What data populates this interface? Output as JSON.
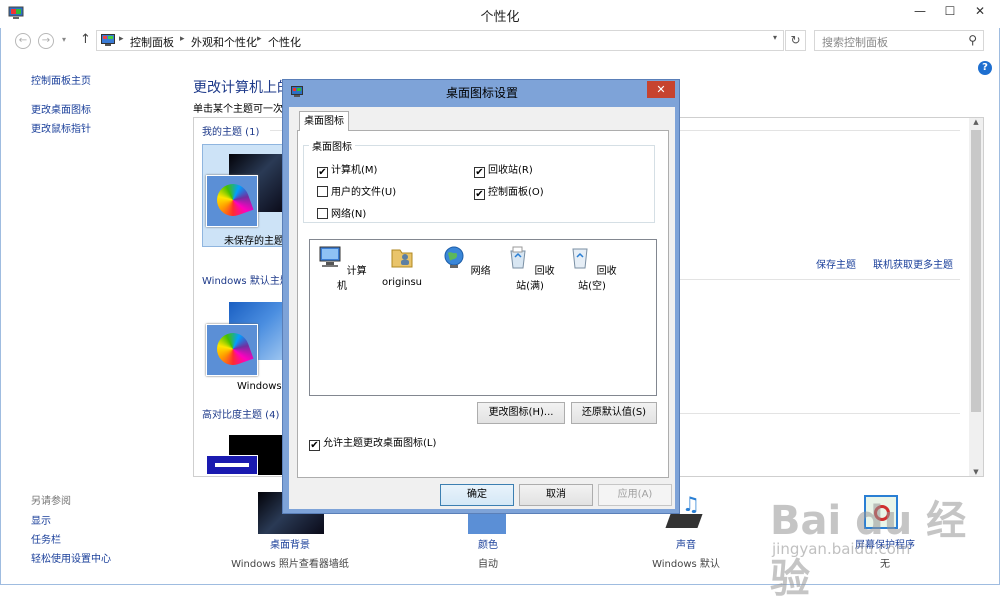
{
  "window": {
    "title": "个性化",
    "min_glyph": "—",
    "max_glyph": "☐",
    "close_glyph": "✕"
  },
  "nav": {
    "back_glyph": "←",
    "forward_glyph": "→",
    "dropdown_glyph": "▾",
    "up_glyph": "↑",
    "breadcrumb": [
      "控制面板",
      "外观和个性化",
      "个性化"
    ],
    "breadcrumb_sep": "▸",
    "refresh_glyph": "↻",
    "search_placeholder": "搜索控制面板",
    "search_glyph": "⚲",
    "help_glyph": "?"
  },
  "sidebar": {
    "home": "控制面板主页",
    "items": [
      "更改桌面图标",
      "更改鼠标指针"
    ],
    "see_also_title": "另请参阅",
    "see_also": [
      "显示",
      "任务栏",
      "轻松使用设置中心"
    ]
  },
  "main": {
    "title": "更改计算机上的视觉效果和声音",
    "subtitle": "单击某个主题可一次",
    "groups": {
      "my_themes": "我的主题 (1)",
      "windows_default": "Windows 默认主题",
      "high_contrast": "高对比度主题 (4)"
    },
    "themes": {
      "unsaved": "未保存的主题",
      "windows": "Windows"
    },
    "links": {
      "save_theme": "保存主题",
      "get_more": "联机获取更多主题"
    }
  },
  "bottom": [
    {
      "label": "桌面背景",
      "value": "Windows 照片查看器墙纸"
    },
    {
      "label": "颜色",
      "value": "自动"
    },
    {
      "label": "声音",
      "value": "Windows 默认"
    },
    {
      "label": "屏幕保护程序",
      "value": "无"
    }
  ],
  "watermark": {
    "text": "Bai du 经验",
    "sub": "jingyan.baidu.com"
  },
  "dialog": {
    "title": "桌面图标设置",
    "close_glyph": "✕",
    "tab": "桌面图标",
    "group_title": "桌面图标",
    "checkboxes": [
      {
        "label": "计算机(M)",
        "checked": true
      },
      {
        "label": "回收站(R)",
        "checked": true
      },
      {
        "label": "用户的文件(U)",
        "checked": false
      },
      {
        "label": "控制面板(O)",
        "checked": true
      },
      {
        "label": "网络(N)",
        "checked": false
      }
    ],
    "check_glyph": "✔",
    "icons": [
      "计算机",
      "originsu",
      "网络",
      "回收站(满)",
      "回收站(空)"
    ],
    "change_icon_button": "更改图标(H)...",
    "restore_default_button": "还原默认值(S)",
    "allow_themes": "允许主题更改桌面图标(L)",
    "allow_themes_checked": true,
    "ok_button": "确定",
    "cancel_button": "取消",
    "apply_button": "应用(A)"
  }
}
